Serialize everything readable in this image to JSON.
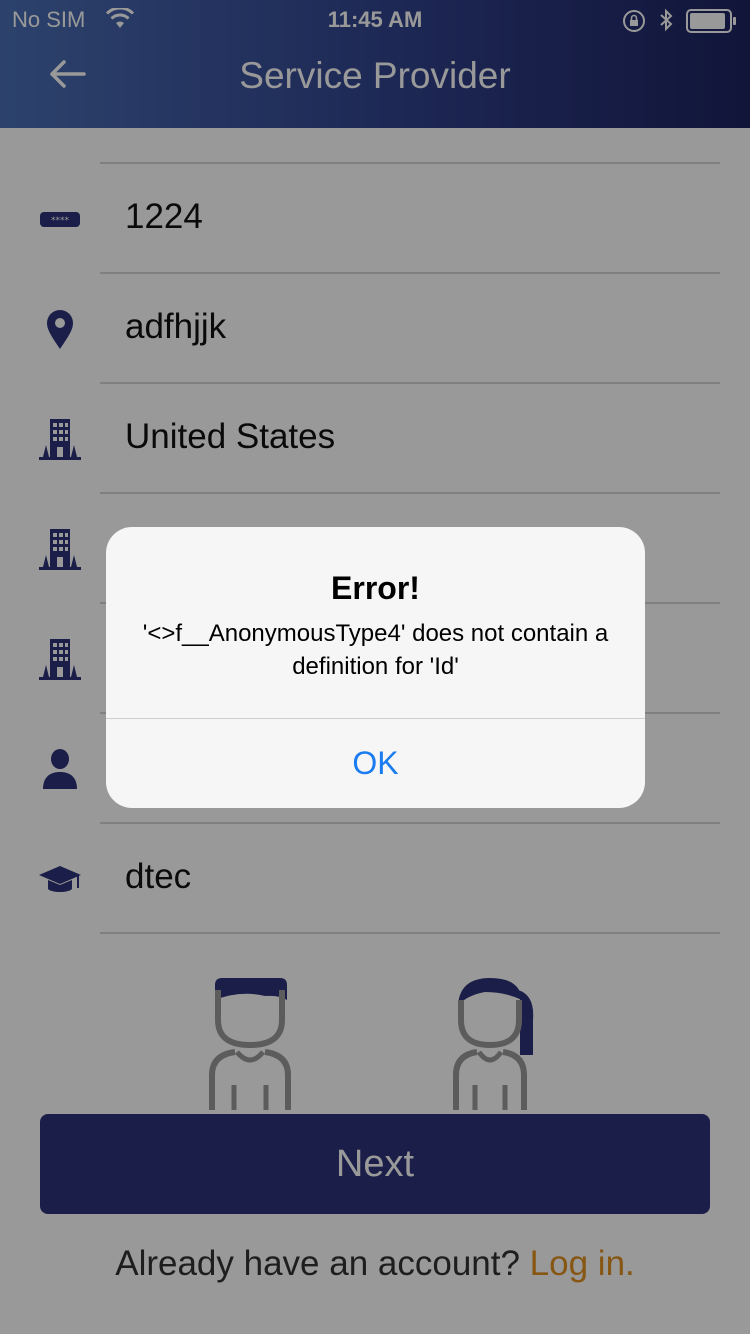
{
  "status_bar": {
    "carrier": "No SIM",
    "time": "11:45 AM",
    "icons": [
      "wifi-icon",
      "rotation-lock-icon",
      "bluetooth-icon",
      "battery-icon"
    ]
  },
  "nav": {
    "title": "Service Provider",
    "back_icon": "back-arrow-icon"
  },
  "form": {
    "rows": [
      {
        "icon": "card-pin-icon",
        "value": "1224"
      },
      {
        "icon": "location-pin-icon",
        "value": "adfhjjk"
      },
      {
        "icon": "building-icon",
        "value": "United States"
      },
      {
        "icon": "building-icon",
        "value": ""
      },
      {
        "icon": "building-icon",
        "value": ""
      },
      {
        "icon": "person-icon",
        "value": ""
      },
      {
        "icon": "graduation-cap-icon",
        "value": "dtec"
      }
    ]
  },
  "avatars": [
    "male-avatar-icon",
    "female-avatar-icon"
  ],
  "next_button": {
    "label": "Next"
  },
  "footer": {
    "prompt": "Already have an account? ",
    "link": "Log in."
  },
  "alert": {
    "title": "Error!",
    "message": "'<>f__AnonymousType4' does not contain a definition for 'Id'",
    "ok_label": "OK"
  },
  "colors": {
    "nav_gradient_start": "#4a6fb4",
    "nav_gradient_end": "#1d2361",
    "primary": "#2c3379",
    "link": "#e0901f",
    "alert_button": "#1a7cf0"
  }
}
